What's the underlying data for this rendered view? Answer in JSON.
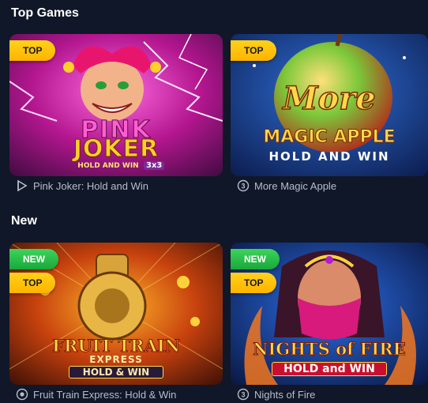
{
  "sections": [
    {
      "title": "Top Games",
      "games": [
        {
          "name": "Pink Joker: Hold and Win",
          "provider_icon": "play-triangle-icon",
          "badges": [
            "TOP"
          ],
          "art": {
            "line1": "PINK",
            "line2": "JOKER",
            "line3": "HOLD AND WIN",
            "line4": "3x3"
          }
        },
        {
          "name": "More Magic Apple",
          "provider_icon": "three-d-circle-icon",
          "badges": [
            "TOP"
          ],
          "art": {
            "line1": "More",
            "line2": "MAGIC APPLE",
            "line3": "HOLD AND WIN"
          }
        }
      ]
    },
    {
      "title": "New",
      "games": [
        {
          "name": "Fruit Train Express: Hold & Win",
          "provider_icon": "ring-dot-icon",
          "badges": [
            "NEW",
            "TOP"
          ],
          "art": {
            "line1": "FRUIT TRAIN",
            "line2": "EXPRESS",
            "line3": "HOLD & WIN"
          }
        },
        {
          "name": "Nights of Fire",
          "provider_icon": "three-d-circle-icon",
          "badges": [
            "NEW",
            "TOP"
          ],
          "art": {
            "line1": "NIGHTS of FIRE",
            "line2": "HOLD and WIN"
          }
        }
      ]
    }
  ],
  "colors": {
    "background": "#101728",
    "badge_top": "#ffc20e",
    "badge_new": "#2bbf4b",
    "caption": "#b7bdcb"
  }
}
